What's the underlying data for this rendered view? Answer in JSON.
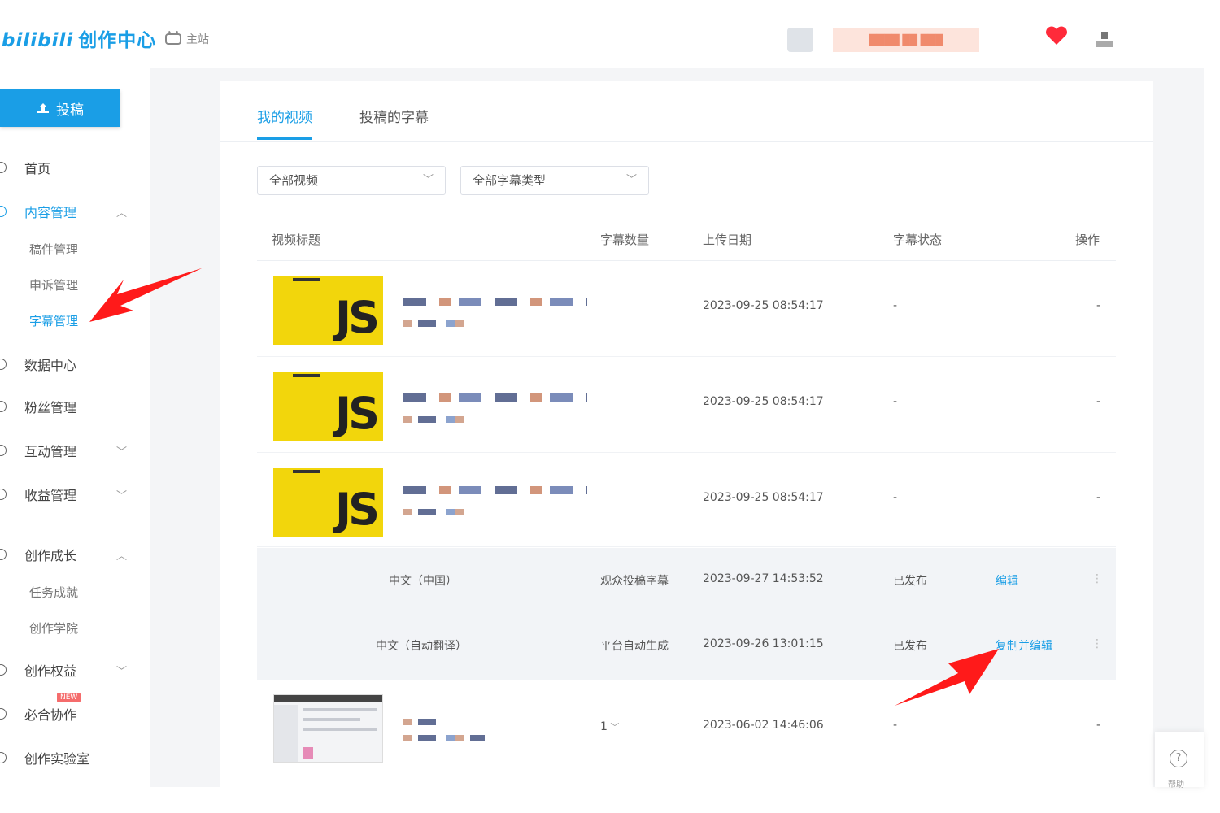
{
  "header": {
    "logo_text": "创作中心",
    "logo_mark": "bilibili",
    "home_link": "主站",
    "user_name": "████ ██ ███"
  },
  "sidebar": {
    "upload_label": "投稿",
    "items": [
      {
        "label": "首页"
      },
      {
        "label": "内容管理",
        "expanded": true,
        "active": true,
        "children": [
          {
            "label": "稿件管理"
          },
          {
            "label": "申诉管理"
          },
          {
            "label": "字幕管理",
            "active": true
          }
        ]
      },
      {
        "label": "数据中心"
      },
      {
        "label": "粉丝管理"
      },
      {
        "label": "互动管理",
        "expanded": false
      },
      {
        "label": "收益管理",
        "expanded": false
      },
      {
        "label": "创作成长",
        "expanded": true,
        "children": [
          {
            "label": "任务成就"
          },
          {
            "label": "创作学院"
          }
        ]
      },
      {
        "label": "创作权益",
        "expanded": false
      },
      {
        "label": "必合协作",
        "badge": "NEW"
      },
      {
        "label": "创作实验室"
      }
    ]
  },
  "main": {
    "tabs": [
      {
        "label": "我的视频",
        "active": true
      },
      {
        "label": "投稿的字幕"
      }
    ],
    "filters": [
      {
        "value": "全部视频"
      },
      {
        "value": "全部字幕类型"
      }
    ],
    "table": {
      "headers": [
        "视频标题",
        "字幕数量",
        "上传日期",
        "字幕状态",
        "操作"
      ],
      "rows": [
        {
          "count": "",
          "date": "2023-09-25 08:54:17",
          "status": "-",
          "action": "-"
        },
        {
          "count": "",
          "date": "2023-09-25 08:54:17",
          "status": "-",
          "action": "-"
        },
        {
          "count": "",
          "date": "2023-09-25 08:54:17",
          "status": "-",
          "action": "-"
        },
        {
          "count": "1",
          "date": "2023-06-02 14:46:06",
          "status": "-",
          "action": "-"
        }
      ],
      "subtitle_rows": [
        {
          "language": "中文（中国）",
          "type": "观众投稿字幕",
          "date": "2023-09-27 14:53:52",
          "status": "已发布",
          "action": "编辑"
        },
        {
          "language": "中文（自动翻译）",
          "type": "平台自动生成",
          "date": "2023-09-26 13:01:15",
          "status": "已发布",
          "action": "复制并编辑"
        }
      ]
    }
  },
  "help": {
    "label": "帮助"
  },
  "colors": {
    "accent": "#1a9ee6",
    "annotation_arrow": "#ff1a1a",
    "thumbnail": "#f2d60c"
  }
}
